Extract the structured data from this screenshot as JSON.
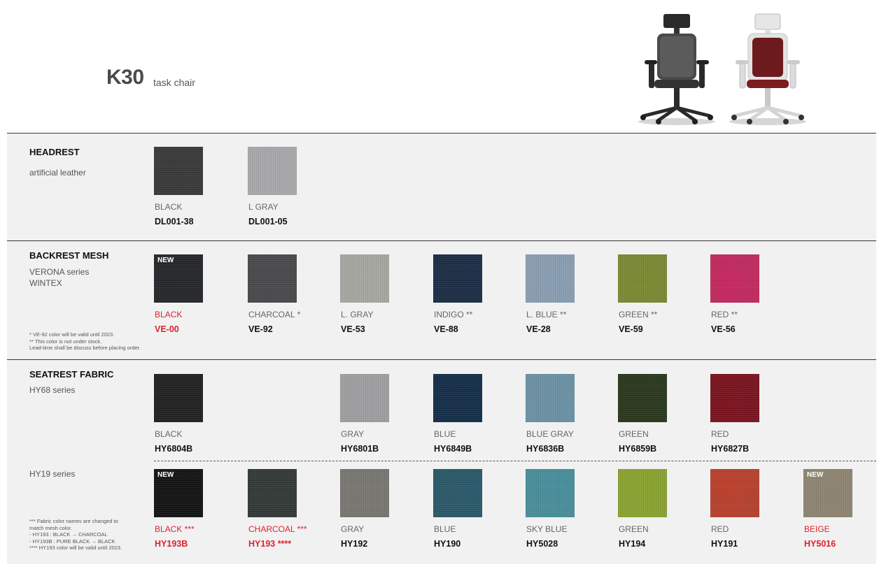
{
  "header": {
    "model": "K30",
    "subtitle": "task chair"
  },
  "colors": {
    "red_accent": "#e0202f",
    "section_bg": "#f1f1f1"
  },
  "headrest": {
    "title": "HEADREST",
    "subtitle": "artificial leather",
    "items": [
      {
        "name": "BLACK",
        "code": "DL001-38",
        "color": "#3b3b3b"
      },
      {
        "name": "L GRAY",
        "code": "DL001-05",
        "color": "#a9a9ab"
      }
    ]
  },
  "backrest": {
    "title": "BACKREST MESH",
    "subtitle": "VERONA series\nWINTEX",
    "note": "* VE-92 color will be valid until 2023.\n** This color is not under stock.\n   Lead-time shall be discuss before placing order.",
    "items": [
      {
        "name": "BLACK",
        "code": "VE-00",
        "color": "#27282c",
        "badge": "NEW",
        "highlight": true
      },
      {
        "name": "CHARCOAL *",
        "code": "VE-92",
        "color": "#4b4b4e"
      },
      {
        "name": "L. GRAY",
        "code": "VE-53",
        "color": "#a7a8a2"
      },
      {
        "name": "INDIGO **",
        "code": "VE-88",
        "color": "#1d2f47"
      },
      {
        "name": "L. BLUE **",
        "code": "VE-28",
        "color": "#8b9fb3"
      },
      {
        "name": "GREEN **",
        "code": "VE-59",
        "color": "#7c8b34"
      },
      {
        "name": "RED **",
        "code": "VE-56",
        "color": "#c42b61"
      }
    ]
  },
  "seatrest": {
    "title": "SEATREST FABRIC",
    "hy68": {
      "subtitle": "HY68 series",
      "items": [
        {
          "name": "BLACK",
          "code": "HY6804B",
          "color": "#232323",
          "col": 0
        },
        {
          "name": "GRAY",
          "code": "HY6801B",
          "color": "#a0a0a3",
          "col": 2
        },
        {
          "name": "BLUE",
          "code": "HY6849B",
          "color": "#16304a",
          "col": 3
        },
        {
          "name": "BLUE GRAY",
          "code": "HY6836B",
          "color": "#6d93a6",
          "col": 4
        },
        {
          "name": "GREEN",
          "code": "HY6859B",
          "color": "#2b3a1f",
          "col": 5
        },
        {
          "name": "RED",
          "code": "HY6827B",
          "color": "#7b1520",
          "col": 6
        }
      ]
    },
    "hy19": {
      "subtitle": "HY19 series",
      "note": "*** Fabric color names are changed to\n     match mesh color.\n   - HY193 : BLACK → CHARCOAL\n   - HY193B : PURE BLACK → BLACK\n**** HY193 color will be valid until 2023.",
      "items": [
        {
          "name": "BLACK ***",
          "code": "HY193B",
          "color": "#151515",
          "badge": "NEW",
          "highlight": true,
          "col": 0
        },
        {
          "name": "CHARCOAL ***",
          "code": "HY193 ****",
          "color": "#343b38",
          "highlight": true,
          "col": 1
        },
        {
          "name": "GRAY",
          "code": "HY192",
          "color": "#7a7873",
          "col": 2
        },
        {
          "name": "BLUE",
          "code": "HY190",
          "color": "#2c5a6a",
          "col": 3
        },
        {
          "name": "SKY BLUE",
          "code": "HY5028",
          "color": "#4a8f9c",
          "col": 4
        },
        {
          "name": "GREEN",
          "code": "HY194",
          "color": "#8ba431",
          "col": 5
        },
        {
          "name": "RED",
          "code": "HY191",
          "color": "#b9422f",
          "col": 6
        },
        {
          "name": "BEIGE",
          "code": "HY5016",
          "color": "#8f8573",
          "badge": "NEW",
          "highlight": true,
          "col": 7
        }
      ]
    }
  }
}
